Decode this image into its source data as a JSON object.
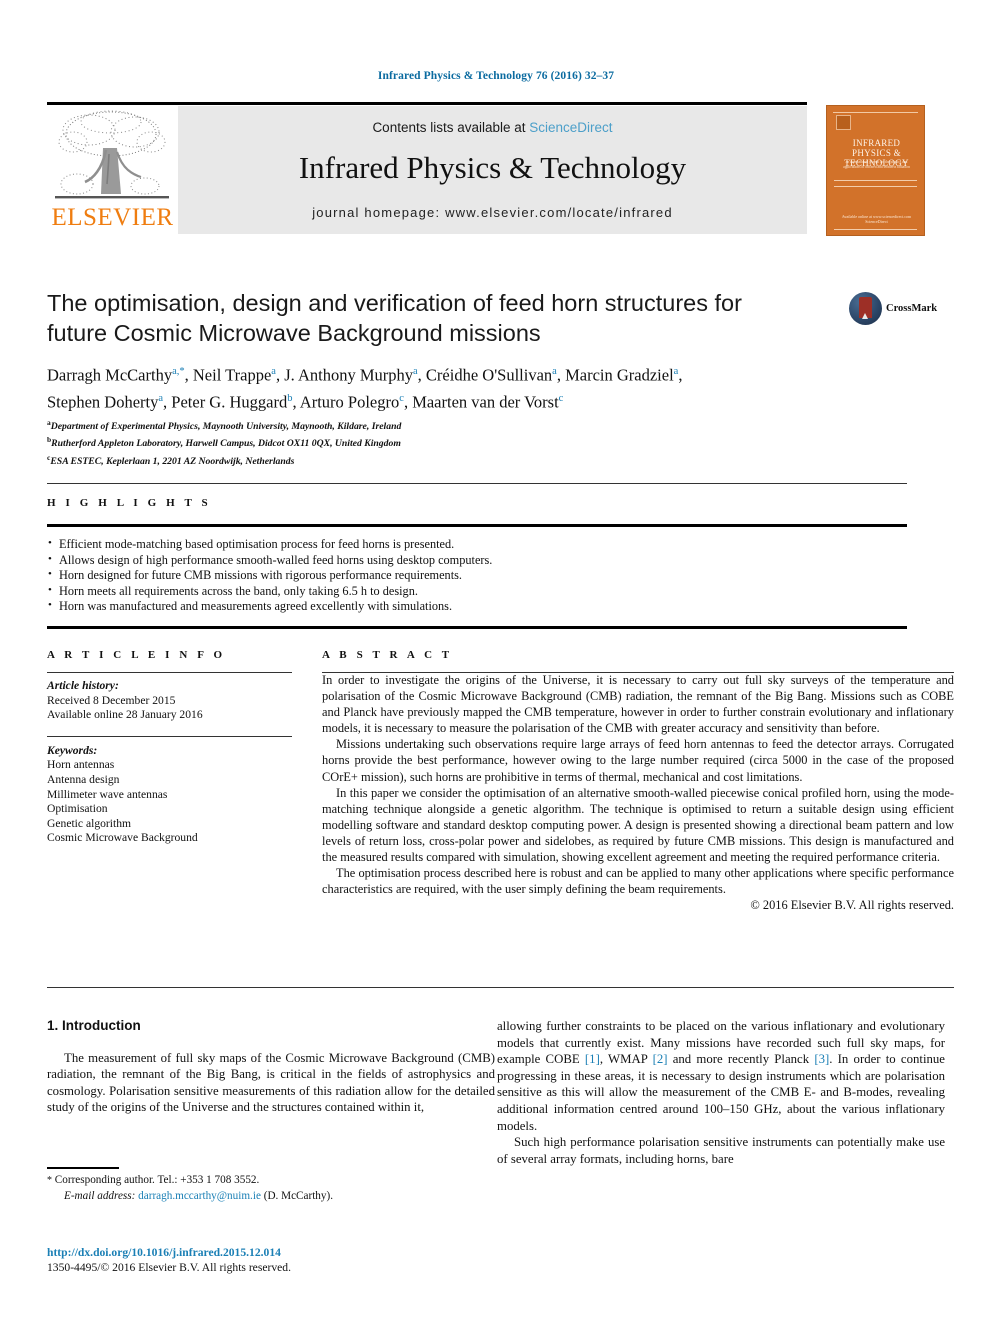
{
  "running_head": "Infrared Physics & Technology 76 (2016) 32–37",
  "masthead": {
    "contents_prefix": "Contents lists available at ",
    "sciencedirect": "ScienceDirect",
    "journal_title": "Infrared Physics & Technology",
    "homepage": "journal homepage: www.elsevier.com/locate/infrared",
    "publisher": "ELSEVIER",
    "cover": {
      "title": "INFRARED PHYSICS & TECHNOLOGY",
      "subtitle": "an international journal for the physics and applications of infrared and terahertz radiation",
      "footer": "Available online at www.sciencedirect.com ScienceDirect"
    }
  },
  "crossmark": {
    "label": "CrossMark"
  },
  "article": {
    "title": "The optimisation, design and verification of feed horn structures for future Cosmic Microwave Background missions",
    "authors_line1": "Darragh McCarthy",
    "authors": "Darragh McCarthy a,*, Neil Trappe a, J. Anthony Murphy a, Créidhe O'Sullivan a, Marcin Gradziel a, Stephen Doherty a, Peter G. Huggard b, Arturo Polegro c, Maarten van der Vorst c",
    "affiliations": [
      "Department of Experimental Physics, Maynooth University, Maynooth, Kildare, Ireland",
      "Rutherford Appleton Laboratory, Harwell Campus, Didcot OX11 0QX, United Kingdom",
      "ESA ESTEC, Keplerlaan 1, 2201 AZ Noordwijk, Netherlands"
    ],
    "affiliation_marks": [
      "a",
      "b",
      "c"
    ]
  },
  "highlights": {
    "heading": "H I G H L I G H T S",
    "items": [
      "Efficient mode-matching based optimisation process for feed horns is presented.",
      "Allows design of high performance smooth-walled feed horns using desktop computers.",
      "Horn designed for future CMB missions with rigorous performance requirements.",
      "Horn meets all requirements across the band, only taking 6.5 h to design.",
      "Horn was manufactured and measurements agreed excellently with simulations."
    ]
  },
  "article_info": {
    "heading": "A R T I C L E   I N F O",
    "history_label": "Article history:",
    "history": [
      "Received 8 December 2015",
      "Available online 28 January 2016"
    ],
    "keywords_label": "Keywords:",
    "keywords": [
      "Horn antennas",
      "Antenna design",
      "Millimeter wave antennas",
      "Optimisation",
      "Genetic algorithm",
      "Cosmic Microwave Background"
    ]
  },
  "abstract": {
    "heading": "A B S T R A C T",
    "paragraphs": [
      "In order to investigate the origins of the Universe, it is necessary to carry out full sky surveys of the temperature and polarisation of the Cosmic Microwave Background (CMB) radiation, the remnant of the Big Bang. Missions such as COBE and Planck have previously mapped the CMB temperature, however in order to further constrain evolutionary and inflationary models, it is necessary to measure the polarisation of the CMB with greater accuracy and sensitivity than before.",
      "Missions undertaking such observations require large arrays of feed horn antennas to feed the detector arrays. Corrugated horns provide the best performance, however owing to the large number required (circa 5000 in the case of the proposed COrE+ mission), such horns are prohibitive in terms of thermal, mechanical and cost limitations.",
      "In this paper we consider the optimisation of an alternative smooth-walled piecewise conical profiled horn, using the mode-matching technique alongside a genetic algorithm. The technique is optimised to return a suitable design using efficient modelling software and standard desktop computing power. A design is presented showing a directional beam pattern and low levels of return loss, cross-polar power and sidelobes, as required by future CMB missions. This design is manufactured and the measured results compared with simulation, showing excellent agreement and meeting the required performance criteria.",
      "The optimisation process described here is robust and can be applied to many other applications where specific performance characteristics are required, with the user simply defining the beam requirements."
    ],
    "copyright": "© 2016 Elsevier B.V. All rights reserved."
  },
  "body": {
    "section_number_title": "1. Introduction",
    "left_paragraph": "The measurement of full sky maps of the Cosmic Microwave Background (CMB) radiation, the remnant of the Big Bang, is critical in the fields of astrophysics and cosmology. Polarisation sensitive measurements of this radiation allow for the detailed study of the origins of the Universe and the structures contained within it,",
    "right_paragraph_1_a": "allowing further constraints to be placed on the various inflationary and evolutionary models that currently exist. Many missions have recorded such full sky maps, for example COBE ",
    "ref1": "[1]",
    "right_paragraph_1_b": ", WMAP ",
    "ref2": "[2]",
    "right_paragraph_1_c": " and more recently Planck ",
    "ref3": "[3]",
    "right_paragraph_1_d": ". In order to continue progressing in these areas, it is necessary to design instruments which are polarisation sensitive as this will allow the measurement of the CMB E- and B-modes, revealing additional information centred around 100–150 GHz, about the various inflationary models.",
    "right_paragraph_2": "Such high performance polarisation sensitive instruments can potentially make use of several array formats, including horns, bare"
  },
  "footnote": {
    "star": "*",
    "corresponding": "Corresponding author. Tel.: +353 1 708 3552.",
    "email_label": "E-mail address:",
    "email": "darragh.mccarthy@nuim.ie",
    "email_suffix": "(D. McCarthy)."
  },
  "doi": {
    "url": "http://dx.doi.org/10.1016/j.infrared.2015.12.014",
    "issn_line": "1350-4495/© 2016 Elsevier B.V. All rights reserved."
  },
  "colors": {
    "link_blue": "#1a7fb5",
    "sciencedirect_blue": "#4c9fc9",
    "elsevier_orange": "#ef7d10",
    "cover_orange": "#d2722a",
    "crossmark_red": "#9d2f26"
  }
}
